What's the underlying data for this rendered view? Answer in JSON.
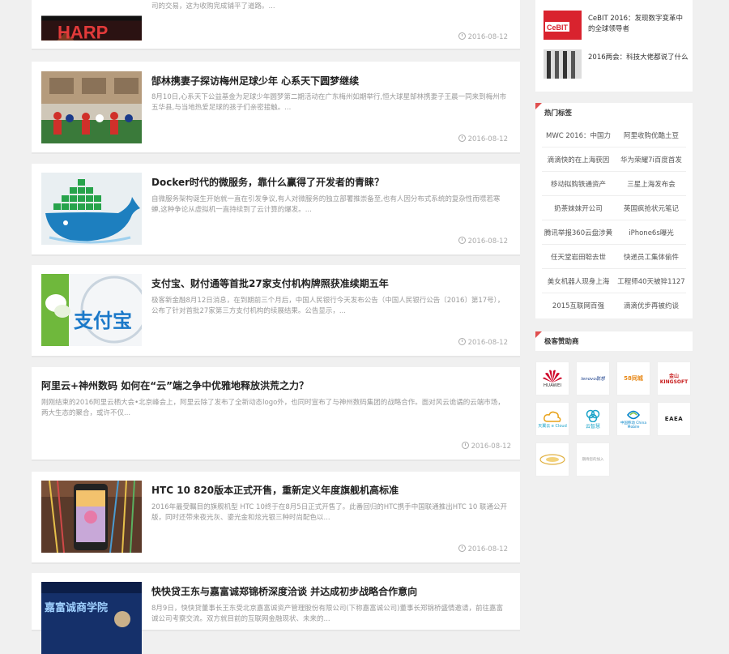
{
  "articles": [
    {
      "title": "",
      "excerpt": "司的交易，这为收购完成铺平了道路。...",
      "date": "2016-08-12",
      "thumb_text": "HARP"
    },
    {
      "title": "郜林携妻子探访梅州足球少年 心系天下圆梦继续",
      "excerpt": "8月10日,心系天下公益基金为足球少年圆梦第二期活动在广东梅州如期举行,恒大球星郜林携妻子王晨一同来到梅州市五华县,与当地热爱足球的孩子们亲密接触。...",
      "date": "2016-08-12"
    },
    {
      "title": "Docker时代的微服务，靠什么赢得了开发者的青睐？",
      "excerpt": "自微服务架构诞生开始就一直在引发争议,有人对微服务的独立部署推崇备至,也有人因分布式系统的复杂性而噤若寒蝉,这种争论从虚拟机一直持续到了云计算的爆发。...",
      "date": "2016-08-12"
    },
    {
      "title": "支付宝、财付通等首批27家支付机构牌照获准续期五年",
      "excerpt": "极客新金融8月12日消息，在到期前三个月后，中国人民银行今天发布公告（中国人民银行公告〔2016〕第17号），公布了针对首批27家第三方支付机构的续展结果。公告显示，...",
      "date": "2016-08-12",
      "thumb_text": "支付宝"
    },
    {
      "title": "阿里云+神州数码 如何在“云”端之争中优雅地释放洪荒之力？",
      "excerpt": "刚刚结束的2016阿里云栖大会•北京峰会上，阿里云除了发布了全新动态logo外，也同时宣布了与神州数码集团的战略合作。面对风云诡谲的云端市场，两大生态的聚合，或许不仅...",
      "date": "2016-08-12"
    },
    {
      "title": "HTC 10 820版本正式开售，重新定义年度旗舰机高标准",
      "excerpt": "2016年最受瞩目的旗舰机型 HTC 10终于在8月5日正式开售了。此番回归的HTC携手中国联通推出HTC 10 联通公开版，同时还带来夜光灰、鎏光金和炫光银三种时尚配色以...",
      "date": "2016-08-12"
    },
    {
      "title": "快快贷王东与嘉富诚郑锦桥深度洽谈 并达成初步战略合作意向",
      "excerpt": "8月9日，快快贷董事长王东受北京嘉富诚资产管理股份有限公司(下称嘉富诚公司)董事长郑锦桥盛情邀请，前往嘉富诚公司考察交流。双方就目前的互联网金融现状、未来的...",
      "thumb_text": "嘉富诚商学院"
    }
  ],
  "sidebar": {
    "recent": [
      {
        "title": "CeBIT 2016：发现数字变革中的全球领导者",
        "thumb_text": "CeBIT"
      },
      {
        "title": "2016两会：科技大佬都说了什么"
      }
    ],
    "hot_tags_title": "热门标签",
    "hot_tags": [
      "MWC 2016：中国力",
      "阿里收购优酷土豆",
      "滴滴快的在上海获因",
      "华为荣耀7i百度首发",
      "移动拟购铁通资产",
      "三星上海发布会",
      "奶茶妹妹开公司",
      "英国疯抢状元笔记",
      "腾讯举报360云盘涉黄",
      "iPhone6s曝光",
      "任天堂岩田聪去世",
      "快递员工集体偷件",
      "美女机器人现身上海",
      "工程师40天被猝1127",
      "2015互联网百强",
      "滴滴优步再被约谈"
    ],
    "sponsors_title": "极客赞助商",
    "sponsors": [
      "HUAWEI",
      "lenovo联想",
      "58同城",
      "金山 KINGSOFT",
      "天翼云 e Cloud",
      "云智慧",
      "中国移动 China Mobile",
      "EAEA",
      "",
      "期待您的加入"
    ]
  },
  "colors": {
    "accent": "#e04e4e",
    "huawei": "#cf0a2c",
    "cloud": "#1aa3c8",
    "mobile": "#0082c8"
  }
}
